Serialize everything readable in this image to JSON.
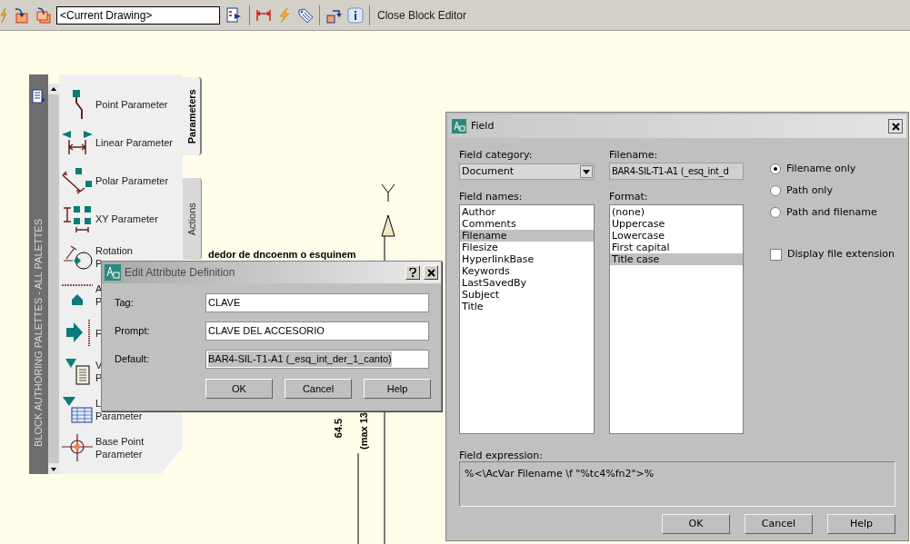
{
  "toolbar": {
    "drawing_combo": "<Current Drawing>",
    "close_label": "Close Block Editor"
  },
  "palette": {
    "side_title": "BLOCK AUTHORING PALETTES - ALL PALETTES",
    "tabs": [
      {
        "label": "Parameters",
        "selected": true
      },
      {
        "label": "Actions",
        "selected": false
      }
    ],
    "items": [
      {
        "kind": "point",
        "lines": [
          "Point Parameter"
        ]
      },
      {
        "kind": "linear",
        "lines": [
          "Linear Parameter"
        ]
      },
      {
        "kind": "polar",
        "lines": [
          "Polar Parameter"
        ]
      },
      {
        "kind": "xy",
        "lines": [
          "XY Parameter"
        ]
      },
      {
        "kind": "rotation",
        "lines": [
          "Rotation",
          "P"
        ]
      },
      {
        "kind": "alignment",
        "lines": [
          "A",
          "P"
        ]
      },
      {
        "kind": "flip",
        "lines": [
          "F"
        ]
      },
      {
        "kind": "visibility",
        "lines": [
          "V",
          "P"
        ]
      },
      {
        "kind": "lookup",
        "lines": [
          "L",
          "Parameter"
        ]
      },
      {
        "kind": "basepoint",
        "lines": [
          "Base Point",
          "Parameter"
        ]
      }
    ]
  },
  "drawing": {
    "note": "dedor de dncoenm o esquinem",
    "dimension": "64.5",
    "dimension_note": "(max 13"
  },
  "attribute_dialog": {
    "title": "Edit Attribute Definition",
    "active": false,
    "fields": [
      {
        "label": "Tag:",
        "value": "CLAVE",
        "selected": false
      },
      {
        "label": "Prompt:",
        "value": "CLAVE DEL ACCESORIO",
        "selected": false
      },
      {
        "label": "Default:",
        "value": "BAR4-SIL-T1-A1 (_esq_int_der_1_canto)",
        "selected": true
      }
    ],
    "buttons": [
      "OK",
      "Cancel",
      "Help"
    ]
  },
  "field_dialog": {
    "title": "Field",
    "category_label": "Field category:",
    "category": "Document",
    "names_label": "Field names:",
    "names": [
      {
        "label": "Author",
        "selected": false
      },
      {
        "label": "Comments",
        "selected": false
      },
      {
        "label": "Filename",
        "selected": true
      },
      {
        "label": "Filesize",
        "selected": false
      },
      {
        "label": "HyperlinkBase",
        "selected": false
      },
      {
        "label": "Keywords",
        "selected": false
      },
      {
        "label": "LastSavedBy",
        "selected": false
      },
      {
        "label": "Subject",
        "selected": false
      },
      {
        "label": "Title",
        "selected": false
      }
    ],
    "filename_label": "Filename:",
    "filename": "BAR4-SIL-T1-A1 (_esq_int_d",
    "format_label": "Format:",
    "formats": [
      {
        "label": "(none)",
        "selected": false
      },
      {
        "label": "Uppercase",
        "selected": false
      },
      {
        "label": "Lowercase",
        "selected": false
      },
      {
        "label": "First capital",
        "selected": false
      },
      {
        "label": "Title case",
        "selected": true
      }
    ],
    "options": [
      {
        "label": "Filename only",
        "selected": true
      },
      {
        "label": "Path only",
        "selected": false
      },
      {
        "label": "Path and filename",
        "selected": false
      }
    ],
    "extension": {
      "label": "Display file extension",
      "checked": false
    },
    "expression_label": "Field expression:",
    "expression": "%<\\AcVar Filename \\f \"%tc4%fn2\">%",
    "buttons": [
      "OK",
      "Cancel",
      "Help"
    ]
  }
}
